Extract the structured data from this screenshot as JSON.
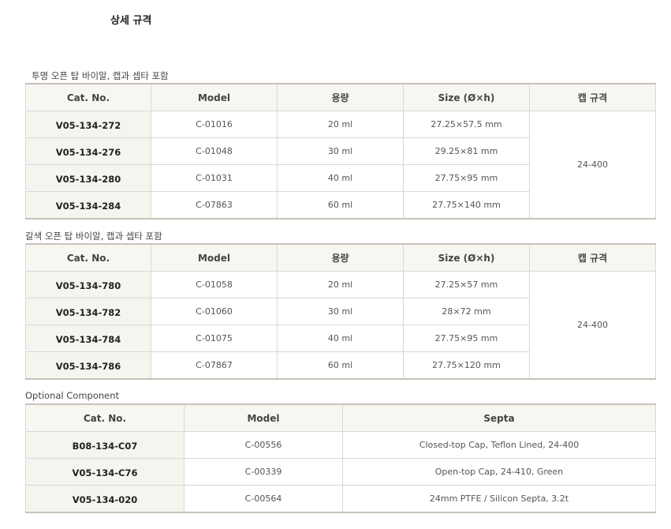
{
  "page_title": "상세 규격",
  "vial_headers": [
    "Cat. No.",
    "Model",
    "용량",
    "Size (Ø×h)",
    "캡 규격"
  ],
  "clear": {
    "caption": "투명 오픈 탑 바이알, 캡과 셉타 포함",
    "cap_spec": "24-400",
    "rows": [
      {
        "cat": "V05-134-272",
        "model": "C-01016",
        "volume": "20 ml",
        "size": "27.25×57.5 mm"
      },
      {
        "cat": "V05-134-276",
        "model": "C-01048",
        "volume": "30 ml",
        "size": "29.25×81 mm"
      },
      {
        "cat": "V05-134-280",
        "model": "C-01031",
        "volume": "40 ml",
        "size": "27.75×95 mm"
      },
      {
        "cat": "V05-134-284",
        "model": "C-07863",
        "volume": "60 ml",
        "size": "27.75×140 mm"
      }
    ]
  },
  "amber": {
    "caption": "갈색 오픈 탑 바이알, 캡과 셉타 포함",
    "cap_spec": "24-400",
    "rows": [
      {
        "cat": "V05-134-780",
        "model": "C-01058",
        "volume": "20 ml",
        "size": "27.25×57 mm"
      },
      {
        "cat": "V05-134-782",
        "model": "C-01060",
        "volume": "30 ml",
        "size": "28×72 mm"
      },
      {
        "cat": "V05-134-784",
        "model": "C-01075",
        "volume": "40 ml",
        "size": "27.75×95 mm"
      },
      {
        "cat": "V05-134-786",
        "model": "C-07867",
        "volume": "60 ml",
        "size": "27.75×120 mm"
      }
    ]
  },
  "optional": {
    "caption": "Optional Component",
    "headers": [
      "Cat. No.",
      "Model",
      "Septa"
    ],
    "rows": [
      {
        "cat": "B08-134-C07",
        "model": "C-00556",
        "septa": "Closed-top Cap, Teflon Lined, 24-400"
      },
      {
        "cat": "V05-134-C76",
        "model": "C-00339",
        "septa": "Open-top Cap, 24-410, Green"
      },
      {
        "cat": "V05-134-020",
        "model": "C-00564",
        "septa": "24mm PTFE / Silicon Septa, 3.2t"
      }
    ]
  }
}
